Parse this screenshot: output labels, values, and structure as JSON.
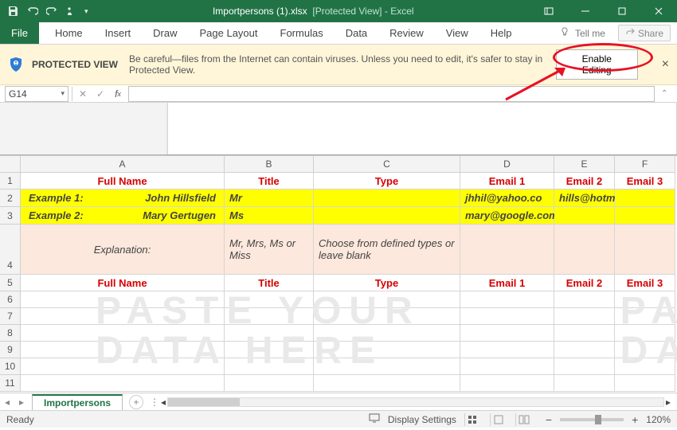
{
  "titlebar": {
    "qat": [
      "save",
      "undo",
      "redo",
      "touch"
    ],
    "filename": "Importpersons (1).xlsx",
    "mode": "[Protected View]",
    "app": "Excel"
  },
  "ribbon": {
    "tabs": [
      "File",
      "Home",
      "Insert",
      "Draw",
      "Page Layout",
      "Formulas",
      "Data",
      "Review",
      "View",
      "Help"
    ],
    "tellme_placeholder": "Tell me",
    "share": "Share"
  },
  "protected_view": {
    "heading": "PROTECTED VIEW",
    "message": "Be careful—files from the Internet can contain viruses. Unless you need to edit, it's safer to stay in Protected View.",
    "button": "Enable Editing"
  },
  "formula_bar": {
    "namebox": "G14",
    "formula": ""
  },
  "columns": [
    "A",
    "B",
    "C",
    "D",
    "E",
    "F"
  ],
  "rows": [
    "1",
    "2",
    "3",
    "4",
    "5",
    "6",
    "7",
    "8",
    "9",
    "10",
    "11"
  ],
  "headers": {
    "fullname": "Full Name",
    "title": "Title",
    "type": "Type",
    "email1": "Email 1",
    "email2": "Email 2",
    "email3": "Email 3"
  },
  "examples": [
    {
      "label": "Example 1:",
      "name": "John Hillsfield",
      "title": "Mr",
      "type": "",
      "e1": "jhhil@yahoo.co",
      "e2": "hills@hotmail.com",
      "e3": ""
    },
    {
      "label": "Example 2:",
      "name": "Mary Gertugen",
      "title": "Ms",
      "type": "",
      "e1": "mary@google.com",
      "e2": "",
      "e3": ""
    }
  ],
  "explanation": {
    "label": "Explanation:",
    "title_hint": "Mr, Mrs, Ms or Miss",
    "type_hint": "Choose from defined types or leave blank"
  },
  "watermark": {
    "line1": "PASTE YOUR",
    "line2": "DATA HERE",
    "right1": "PA",
    "right2": "DA"
  },
  "sheet_tab": "Importpersons",
  "statusbar": {
    "ready": "Ready",
    "display": "Display Settings",
    "zoom": "120%"
  }
}
